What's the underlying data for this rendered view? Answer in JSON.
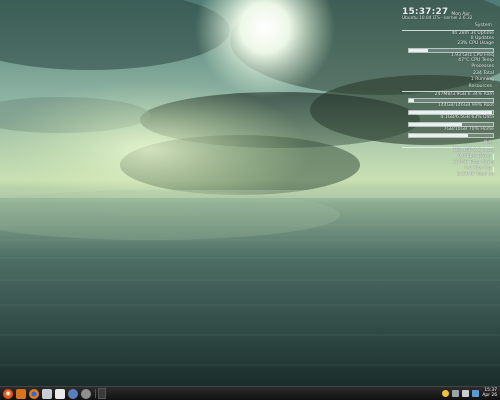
{
  "conky": {
    "time": "15:37:27",
    "date": "Mon Apr",
    "subtitle": "Ubuntu 10.04 LTS - kernel 2.6.32",
    "system": {
      "title": "System",
      "rows": [
        "4h 28m 3s  Uptime",
        "0  Updates",
        "23%  CPU Usage",
        "1.93 GHz  CPU Freq",
        "47°C  CPU Temp",
        "Processes"
      ],
      "cpu_bar": 0.23
    },
    "proc": {
      "rows": [
        "234  Total",
        "1  Running"
      ]
    },
    "resources": {
      "title": "Resources",
      "rows": [
        "247MB/3.9GB  6.34%  Ram",
        "144GB/146GB  99%  Root",
        "4.1GB/6.5GB  63%  Data",
        "7GB/10GB  70%  Home"
      ],
      "bars": [
        0.06,
        0.99,
        0.63,
        0.7
      ]
    },
    "net": {
      "title": "Net",
      "rows": [
        "192.168.2.2  Local",
        "0.0  Kb/s  Down",
        "114MB  Total  down",
        "0.0  Kb/s  Up",
        "5.03MB  Total  up"
      ]
    }
  },
  "taskbar": {
    "launchers": [
      "ubuntu-icon",
      "folder-icon",
      "firefox-icon",
      "mail-icon",
      "document-icon",
      "chat-icon",
      "settings-icon"
    ],
    "clock_time": "15:37",
    "clock_date": "Apr 26"
  },
  "colors": {
    "sky_light": "#f4ffe8",
    "sea_dark": "#17302d",
    "cloud_dark": "#2b3b2a"
  }
}
